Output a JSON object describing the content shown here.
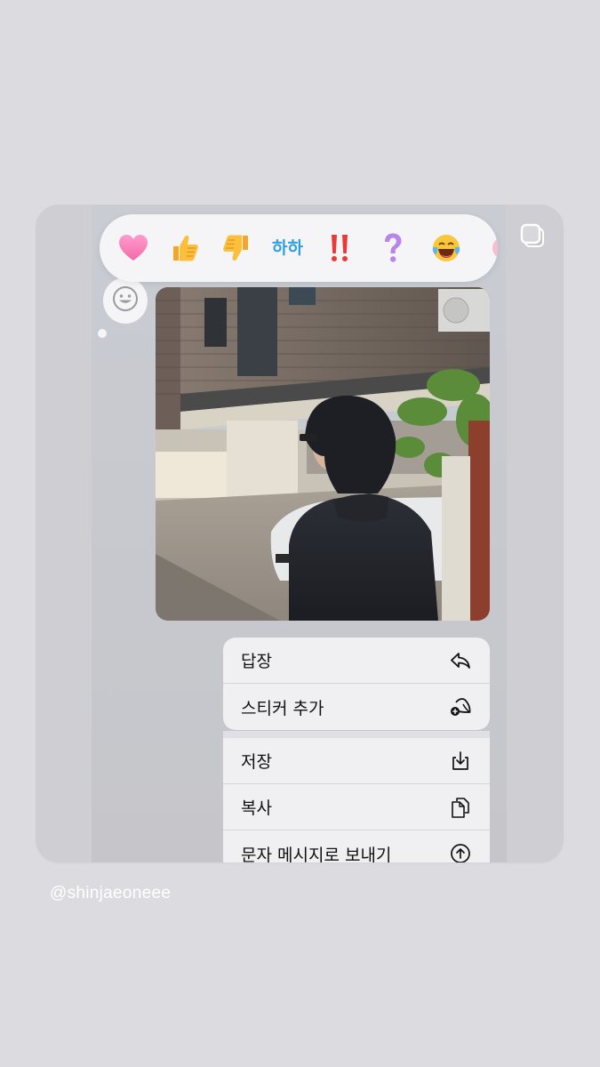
{
  "reactions": [
    {
      "name": "heart",
      "glyph": "💗"
    },
    {
      "name": "thumbs-up",
      "glyph": "👍"
    },
    {
      "name": "thumbs-down",
      "glyph": "👎"
    },
    {
      "name": "haha",
      "glyph": "하하"
    },
    {
      "name": "exclamation",
      "glyph": "‼️"
    },
    {
      "name": "question",
      "glyph": "❓"
    },
    {
      "name": "laugh-tears",
      "glyph": "😂"
    },
    {
      "name": "partial",
      "glyph": "🩷"
    }
  ],
  "menu": {
    "items": [
      {
        "label": "답장",
        "icon": "reply-icon"
      },
      {
        "label": "스티커 추가",
        "icon": "add-sticker-icon"
      },
      {
        "label": "저장",
        "icon": "save-icon"
      },
      {
        "label": "복사",
        "icon": "copy-icon"
      },
      {
        "label": "문자 메시지로 보내기",
        "icon": "send-sms-icon"
      }
    ]
  },
  "watermark": {
    "username": "@shinjaeoneee"
  },
  "colors": {
    "background": "#dcdce0",
    "menu_bg": "#f0f0f2",
    "reaction_bg": "#f5f5f7"
  }
}
